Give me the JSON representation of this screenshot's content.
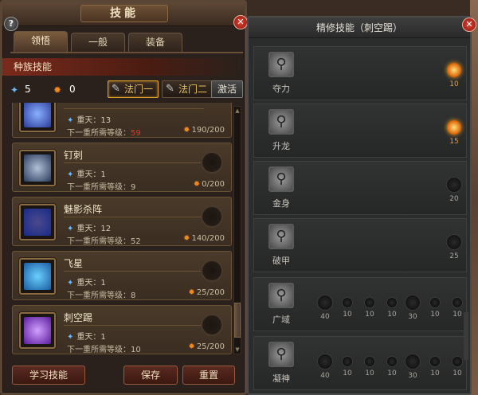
{
  "left": {
    "title": "技能",
    "help_label": "?",
    "close_label": "✕",
    "tabs": [
      {
        "label": "领悟",
        "active": true
      },
      {
        "label": "一般",
        "active": false
      },
      {
        "label": "装备",
        "active": false
      }
    ],
    "race_label": "种族技能",
    "points": {
      "blue": "5",
      "orange": "0"
    },
    "paths": [
      {
        "label": "法门一",
        "active": true
      },
      {
        "label": "法门二",
        "active": false
      }
    ],
    "activate_label": "激活",
    "skills": [
      {
        "name": "",
        "level": "重天：13",
        "req_prefix": "下一重所需等级：",
        "req_level": "59",
        "req_red": true,
        "exp": "190/200",
        "icon_color": "#2a3a9a"
      },
      {
        "name": "钉刺",
        "level": "重天：1",
        "req_prefix": "下一重所需等级：",
        "req_level": "9",
        "req_red": false,
        "exp": "0/200",
        "icon_color": "#3a4a6a"
      },
      {
        "name": "魅影杀阵",
        "level": "重天：12",
        "req_prefix": "下一重所需等级：",
        "req_level": "52",
        "req_red": false,
        "exp": "140/200",
        "icon_color": "#2a4aaa"
      },
      {
        "name": "飞星",
        "level": "重天：1",
        "req_prefix": "下一重所需等级：",
        "req_level": "8",
        "req_red": false,
        "exp": "25/200",
        "icon_color": "#1a6ab0"
      },
      {
        "name": "刺空踢",
        "level": "重天：1",
        "req_prefix": "下一重所需等级：",
        "req_level": "10",
        "req_red": false,
        "exp": "25/200",
        "icon_color": "#6a2a9a"
      }
    ],
    "buttons": {
      "learn": "学习技能",
      "save": "保存",
      "reset": "重置"
    }
  },
  "right": {
    "title": "精修技能（刺空踢）",
    "close_label": "✕",
    "rows": [
      {
        "name": "夺力",
        "nodes": [
          {
            "value": "10",
            "lit": true,
            "kind": "star"
          }
        ]
      },
      {
        "name": "升龙",
        "nodes": [
          {
            "value": "15",
            "lit": true,
            "kind": "star"
          }
        ]
      },
      {
        "name": "金身",
        "nodes": [
          {
            "value": "20",
            "lit": false,
            "kind": "star"
          }
        ]
      },
      {
        "name": "破甲",
        "nodes": [
          {
            "value": "25",
            "lit": false,
            "kind": "star"
          }
        ]
      },
      {
        "name": "广域",
        "nodes": [
          {
            "value": "40",
            "lit": false,
            "kind": "star"
          },
          {
            "value": "10",
            "lit": false,
            "kind": "dot"
          },
          {
            "value": "10",
            "lit": false,
            "kind": "dot"
          },
          {
            "value": "10",
            "lit": false,
            "kind": "dot"
          },
          {
            "value": "30",
            "lit": false,
            "kind": "star"
          },
          {
            "value": "10",
            "lit": false,
            "kind": "dot"
          },
          {
            "value": "10",
            "lit": false,
            "kind": "dot"
          }
        ]
      },
      {
        "name": "凝神",
        "nodes": [
          {
            "value": "40",
            "lit": false,
            "kind": "star"
          },
          {
            "value": "10",
            "lit": false,
            "kind": "dot"
          },
          {
            "value": "10",
            "lit": false,
            "kind": "dot"
          },
          {
            "value": "10",
            "lit": false,
            "kind": "dot"
          },
          {
            "value": "30",
            "lit": false,
            "kind": "star"
          },
          {
            "value": "10",
            "lit": false,
            "kind": "dot"
          },
          {
            "value": "10",
            "lit": false,
            "kind": "dot"
          }
        ]
      }
    ]
  },
  "icons": {
    "blue_point": "blue-diamond-icon",
    "orange_point": "orange-flame-icon",
    "path": "brush-pen-icon",
    "refine_skill": "kick-skill-icon"
  },
  "colors": {
    "accent_gold": "#e8c060",
    "red_text": "#e03a2a",
    "blue_point": "#6ab8ff",
    "orange_point": "#f08a20"
  }
}
